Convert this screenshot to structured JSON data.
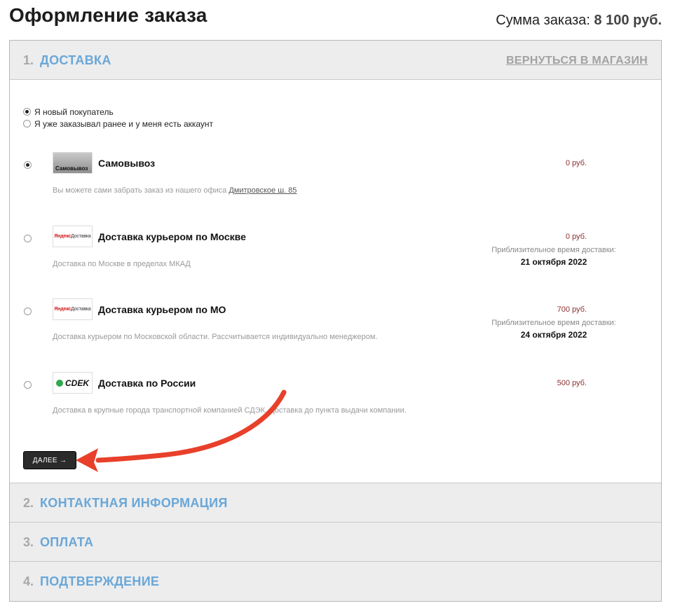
{
  "header": {
    "title": "Оформление заказа",
    "sum_label": "Сумма заказа:",
    "sum_value": "8 100 руб."
  },
  "steps": [
    {
      "num": "1.",
      "title": "ДОСТАВКА",
      "back_label": "ВЕРНУТЬСЯ В МАГАЗИН"
    },
    {
      "num": "2.",
      "title": "КОНТАКТНАЯ ИНФОРМАЦИЯ"
    },
    {
      "num": "3.",
      "title": "ОПЛАТА"
    },
    {
      "num": "4.",
      "title": "ПОДТВЕРЖДЕНИЕ"
    }
  ],
  "customer_type": {
    "selected": 0,
    "options": [
      "Я новый покупатель",
      "Я уже заказывал ранее и у меня есть аккаунт"
    ]
  },
  "delivery": {
    "selected": 0,
    "options": [
      {
        "logo": "Самовывоз",
        "name": "Самовывоз",
        "price": "0 руб.",
        "desc": "Вы можете сами забрать заказ из нашего офиса",
        "desc_link": "Дмитровское ш. 85"
      },
      {
        "logo_prefix": "Яндекс",
        "logo": "Доставка",
        "name": "Доставка курьером по Москве",
        "price": "0 руб.",
        "eta_label": "Приблизительное время доставки:",
        "eta_date": "21 октября 2022",
        "desc": "Доставка по Москве в пределах МКАД"
      },
      {
        "logo_prefix": "Яндекс",
        "logo": "Доставка",
        "name": "Доставка курьером по МО",
        "price": "700 руб.",
        "eta_label": "Приблизительное время доставки:",
        "eta_date": "24 октября 2022",
        "desc": "Доставка курьером по Московской области. Рассчитывается индивидуально менеджером."
      },
      {
        "logo": "CDEK",
        "name": "Доставка по России",
        "price": "500 руб.",
        "desc": "Доставка в крупные города транспортной компанией СДЭК. Доставка до пункта выдачи компании."
      }
    ]
  },
  "next_button": "ДАЛЕЕ →",
  "annotation": {
    "color": "#e8402a",
    "icon": "red-curved-arrow"
  }
}
